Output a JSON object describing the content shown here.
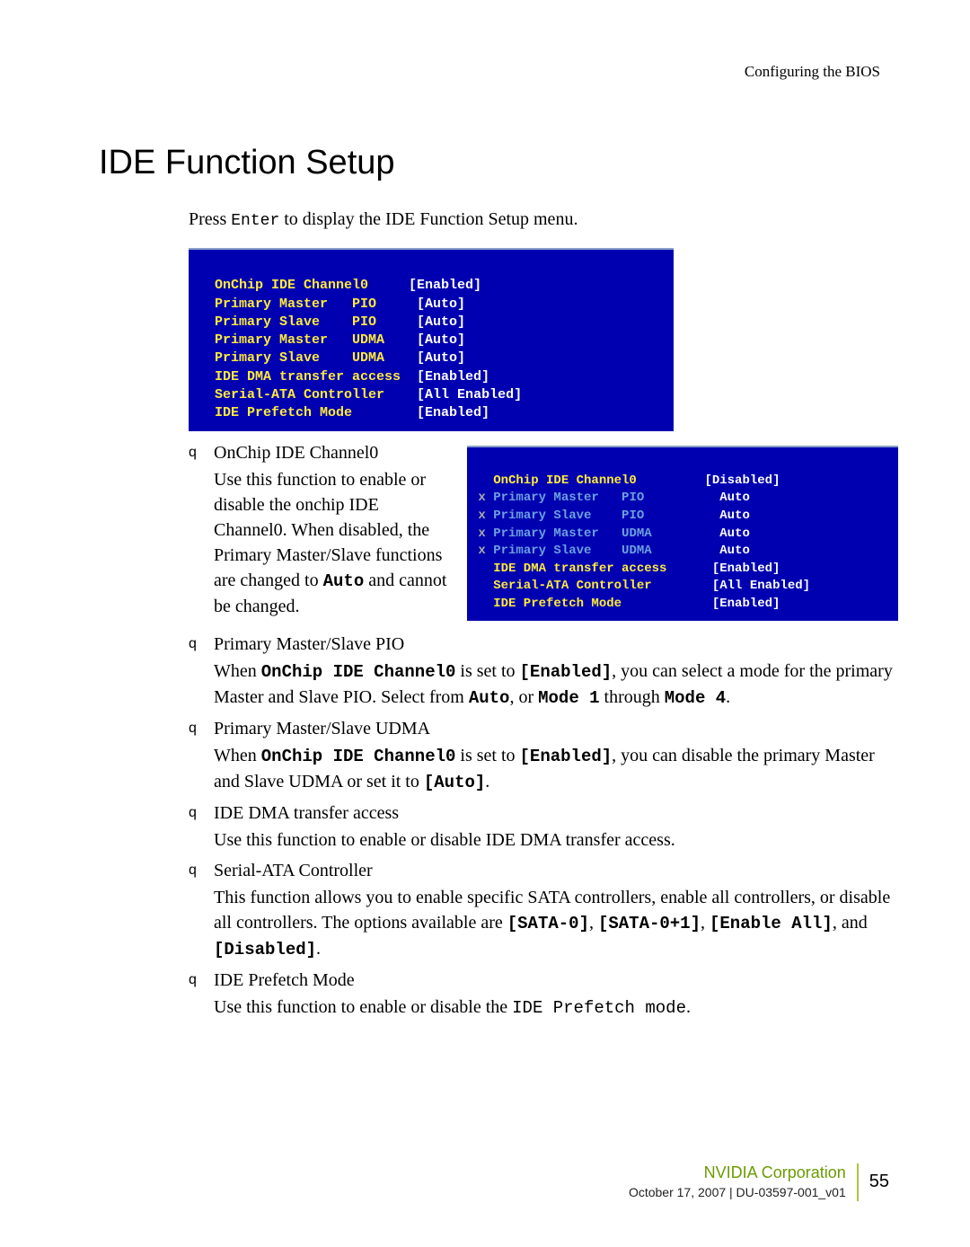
{
  "header": {
    "breadcrumb": "Configuring the BIOS"
  },
  "title": "IDE Function Setup",
  "intro_pre": "Press ",
  "intro_mono": "Enter",
  "intro_post": " to display the IDE Function Setup menu.",
  "bios1": {
    "l1a": " OnChip IDE Channel0",
    "l1b": "     [Enabled]",
    "l2a": " Primary Master   PIO",
    "l2b": "     [Auto]",
    "l3a": " Primary Slave    PIO",
    "l3b": "     [Auto]",
    "l4a": " Primary Master   UDMA",
    "l4b": "    [Auto]",
    "l5a": " Primary Slave    UDMA",
    "l5b": "    [Auto]",
    "l6a": " IDE DMA transfer access",
    "l6b": "  [Enabled]",
    "l7a": " Serial-ATA Controller",
    "l7b": "    [All Enabled]",
    "l8a": " IDE Prefetch Mode",
    "l8b": "        [Enabled]"
  },
  "items": [
    {
      "title": "OnChip IDE Channel0",
      "desc_parts": [
        "Use this function to enable or disable the onchip IDE Channel0. When disabled, the Primary Master/Slave functions are changed to ",
        "Auto",
        " and cannot be changed."
      ]
    },
    {
      "title": "Primary Master/Slave PIO",
      "pio_parts": [
        "When ",
        "OnChip IDE Channel0",
        " is set to ",
        "[Enabled]",
        ", you can select a mode for the primary Master and Slave PIO. Select from ",
        "Auto",
        ", or ",
        "Mode 1",
        " through ",
        "Mode 4",
        "."
      ]
    },
    {
      "title": "Primary Master/Slave UDMA",
      "udma_parts": [
        "When ",
        "OnChip IDE Channel0",
        " is set to ",
        "[Enabled]",
        ", you can disable the primary Master and Slave UDMA or set it to ",
        "[Auto]",
        "."
      ]
    },
    {
      "title": "IDE DMA transfer access",
      "desc": "Use this function to enable or disable IDE DMA transfer access."
    },
    {
      "title": "Serial-ATA Controller",
      "sata_parts": [
        "This function allows you to enable specific SATA controllers, enable all controllers, or disable all controllers. The options available are ",
        "[SATA-0]",
        ", ",
        "[SATA-0+1]",
        ", ",
        "[Enable All]",
        ", and ",
        "[Disabled]",
        "."
      ]
    },
    {
      "title": "IDE Prefetch Mode",
      "pre_parts": [
        "Use this function to enable or disable the ",
        "IDE Prefetch mode",
        "."
      ]
    }
  ],
  "bios2": {
    "l1a": "   OnChip IDE Channel0",
    "l1b": "         [Disabled]",
    "l2x": " x",
    "l2a": " Primary Master   PIO",
    "l2b": "          Auto",
    "l3x": " x",
    "l3a": " Primary Slave    PIO",
    "l3b": "          Auto",
    "l4x": " x",
    "l4a": " Primary Master   UDMA",
    "l4b": "         Auto",
    "l5x": " x",
    "l5a": " Primary Slave    UDMA",
    "l5b": "         Auto",
    "l6a": "   IDE DMA transfer access",
    "l6b": "      [Enabled]",
    "l7a": "   Serial-ATA Controller",
    "l7b": "        [All Enabled]",
    "l8a": "   IDE Prefetch Mode",
    "l8b": "            [Enabled]"
  },
  "footer": {
    "nvidia": "NVIDIA Corporation",
    "date": "October 17, 2007  |  DU-03597-001_v01",
    "page": "55"
  },
  "bullet": "q"
}
